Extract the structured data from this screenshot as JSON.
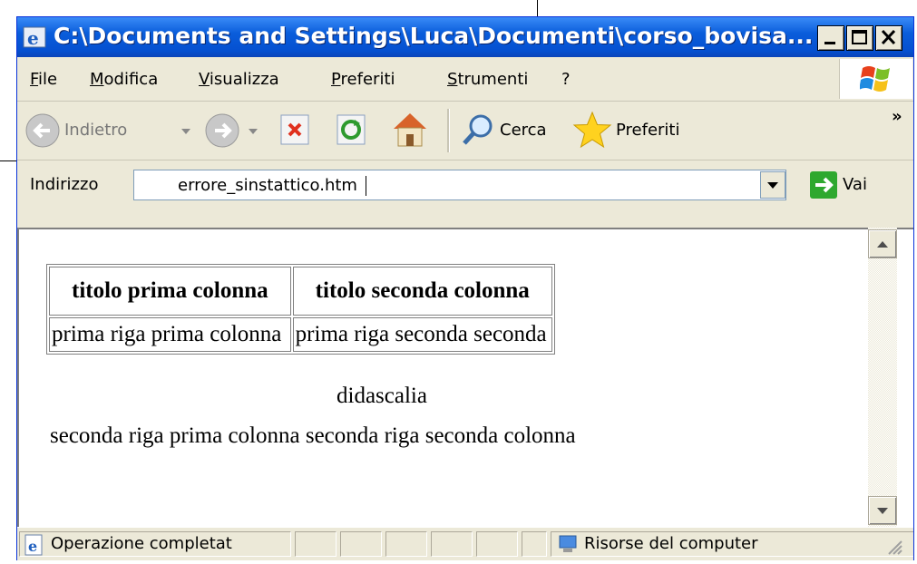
{
  "window": {
    "title": "C:\\Documents and Settings\\Luca\\Documenti\\corso_bovisa..."
  },
  "menu": [
    "File",
    "Modifica",
    "Visualizza",
    "Preferiti",
    "Strumenti",
    "?"
  ],
  "toolbar": {
    "back_label": "Indietro",
    "search_label": "Cerca",
    "favorites_label": "Preferiti",
    "overflow": "»"
  },
  "address": {
    "label": "Indirizzo",
    "value": "errore_sinstattico.htm",
    "go_label": "Vai"
  },
  "page": {
    "table": {
      "headers": [
        "titolo prima colonna",
        "titolo seconda colonna"
      ],
      "rows": [
        [
          "prima riga prima colonna",
          "prima riga seconda seconda"
        ]
      ]
    },
    "caption": "didascalia",
    "second_row_text": "seconda riga prima colonna seconda riga seconda colonna"
  },
  "status": {
    "text": "Operazione completat",
    "zone": "Risorse del computer"
  },
  "colors": {
    "title_bar": "#0a5ddb",
    "chrome": "#ece9d8",
    "close_red": "#e0301e"
  }
}
